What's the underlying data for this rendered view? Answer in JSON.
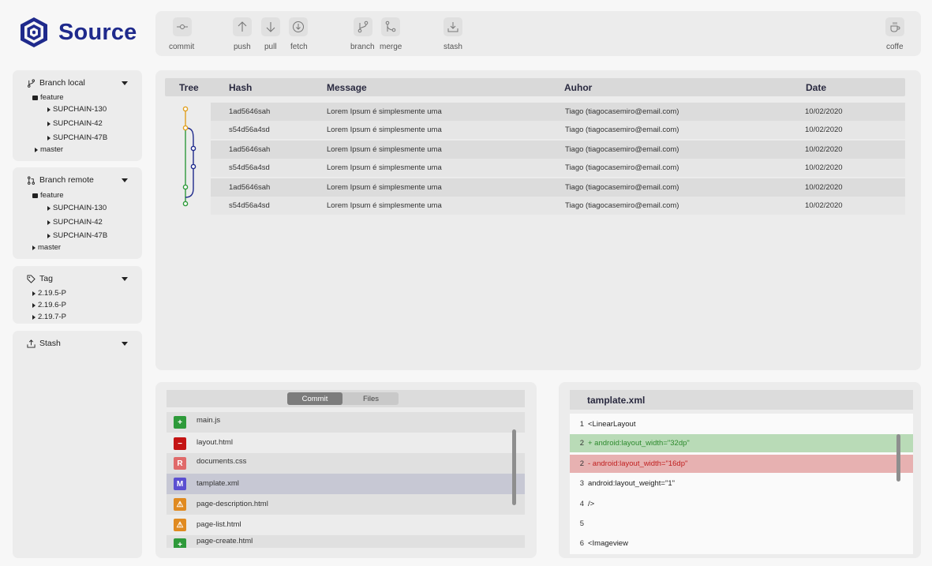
{
  "app": {
    "name": "Source",
    "brand_color": "#1f2a8c"
  },
  "toolbar": {
    "commit": {
      "label": "commit",
      "icon": "commit-icon"
    },
    "push": {
      "label": "push",
      "icon": "arrow-up-icon"
    },
    "pull": {
      "label": "pull",
      "icon": "arrow-down-icon"
    },
    "fetch": {
      "label": "fetch",
      "icon": "download-circle-icon"
    },
    "branch": {
      "label": "branch",
      "icon": "branch-icon"
    },
    "merge": {
      "label": "merge",
      "icon": "merge-icon"
    },
    "stash": {
      "label": "stash",
      "icon": "stash-icon"
    },
    "coffe": {
      "label": "coffe",
      "icon": "coffee-icon"
    }
  },
  "sidebar": {
    "branch_local": {
      "title": "Branch local",
      "folder": "feature",
      "children": [
        "SUPCHAIN-130",
        "SUPCHAIN-42",
        "SUPCHAIN-47B"
      ],
      "other": "master"
    },
    "branch_remote": {
      "title": "Branch remote",
      "folder": "feature",
      "children": [
        "SUPCHAIN-130",
        "SUPCHAIN-42",
        "SUPCHAIN-47B"
      ],
      "other": "master"
    },
    "tag": {
      "title": "Tag",
      "items": [
        "2.19.5-P",
        "2.19.6-P",
        "2.19.7-P"
      ]
    },
    "stash": {
      "title": "Stash"
    }
  },
  "history": {
    "columns": {
      "tree": "Tree",
      "hash": "Hash",
      "message": "Message",
      "author": "Auhor",
      "date": "Date"
    },
    "rows": [
      {
        "hash": "1ad5646sah",
        "message": "Lorem Ipsum é simplesmente uma",
        "author": "Tiago (tiagocasemiro@email.com)",
        "date": "10/02/2020"
      },
      {
        "hash": "s54d56a4sd",
        "message": "Lorem Ipsum é simplesmente uma",
        "author": "Tiago (tiagocasemiro@email.com)",
        "date": "10/02/2020"
      },
      {
        "hash": "1ad5646sah",
        "message": "Lorem Ipsum é simplesmente uma",
        "author": "Tiago (tiagocasemiro@email.com)",
        "date": "10/02/2020"
      },
      {
        "hash": "s54d56a4sd",
        "message": "Lorem Ipsum é simplesmente uma",
        "author": "Tiago (tiagocasemiro@email.com)",
        "date": "10/02/2020"
      },
      {
        "hash": "1ad5646sah",
        "message": "Lorem Ipsum é simplesmente uma",
        "author": "Tiago (tiagocasemiro@email.com)",
        "date": "10/02/2020"
      },
      {
        "hash": "s54d56a4sd",
        "message": "Lorem Ipsum é simplesmente uma",
        "author": "Tiago (tiagocasemiro@email.com)",
        "date": "10/02/2020"
      }
    ],
    "graph_colors": {
      "orange": "#e0a020",
      "green": "#2e9a3a",
      "blue": "#1f2a8c"
    }
  },
  "files": {
    "tabs": {
      "commit": "Commit",
      "files": "Files"
    },
    "items": [
      {
        "name": "main.js",
        "status": "+",
        "color": "#2e9a3a"
      },
      {
        "name": "layout.html",
        "status": "−",
        "color": "#c41414"
      },
      {
        "name": "documents.css",
        "status": "R",
        "color": "#e06a6a"
      },
      {
        "name": "tamplate.xml",
        "status": "M",
        "color": "#5b4fd1"
      },
      {
        "name": "page-description.html",
        "status": "⚠",
        "color": "#e08a20"
      },
      {
        "name": "page-list.html",
        "status": "⚠",
        "color": "#e08a20"
      },
      {
        "name": "page-create.html",
        "status": "+",
        "color": "#2e9a3a"
      }
    ]
  },
  "diff": {
    "title": "tamplate.xml",
    "lines": [
      {
        "n": "1",
        "text": "<LinearLayout",
        "kind": "ctx"
      },
      {
        "n": "2",
        "text": "+ android:layout_width=\"32dp\"",
        "kind": "add"
      },
      {
        "n": "2",
        "text": "- android:layout_width=\"16dp\"",
        "kind": "del"
      },
      {
        "n": "3",
        "text": "android:layout_weight=\"1\"",
        "kind": "ctx"
      },
      {
        "n": "4",
        "text": "/>",
        "kind": "ctx"
      },
      {
        "n": "5",
        "text": "",
        "kind": "ctx"
      },
      {
        "n": "6",
        "text": "<Imageview",
        "kind": "ctx"
      }
    ]
  }
}
